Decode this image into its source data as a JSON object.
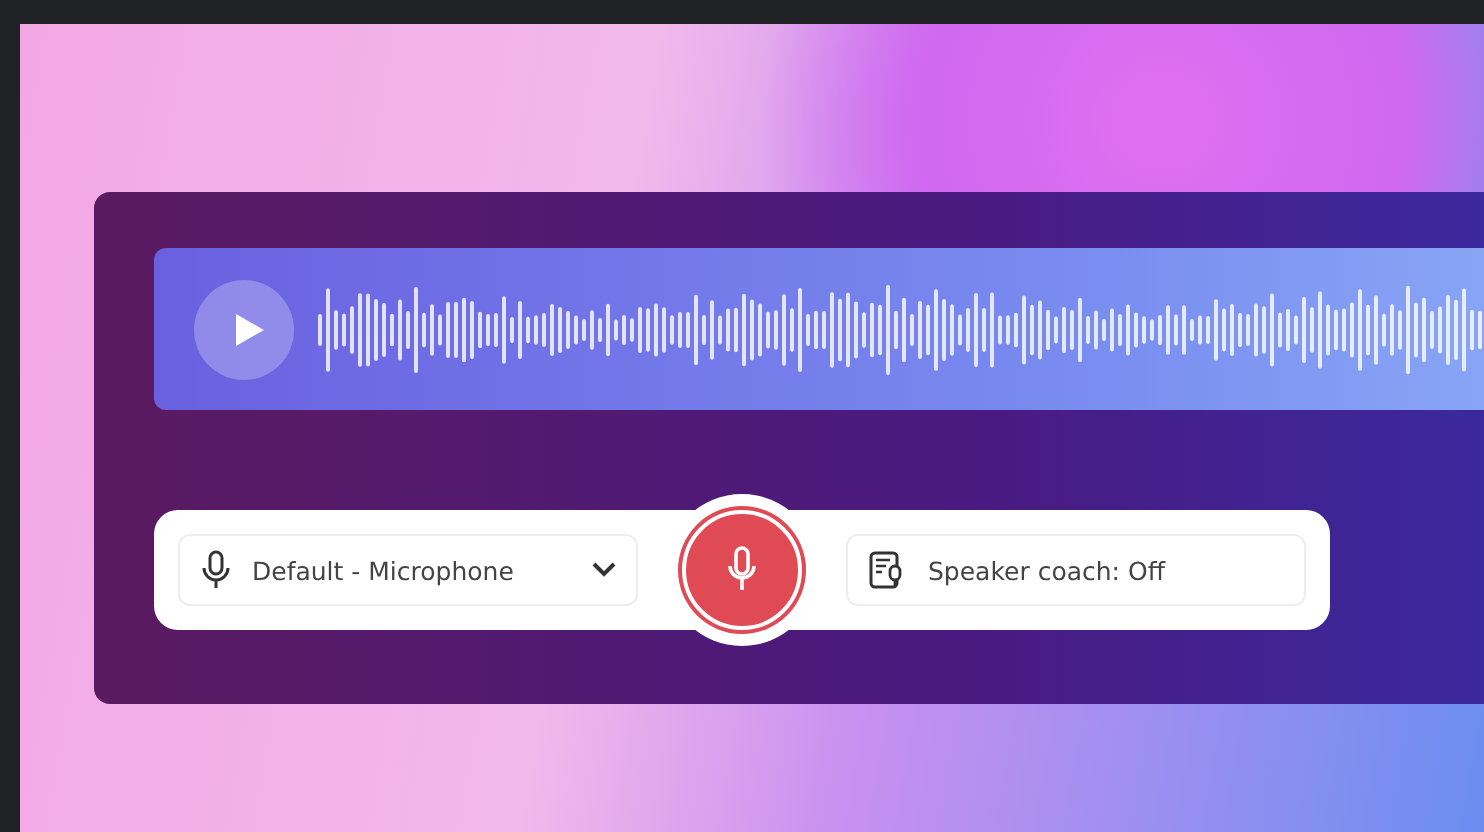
{
  "player": {
    "play_button": {
      "kind": "play"
    }
  },
  "recorder": {
    "microphone": {
      "value": "Default - Microphone"
    },
    "speaker_coach": {
      "label": "Speaker coach: Off"
    }
  }
}
